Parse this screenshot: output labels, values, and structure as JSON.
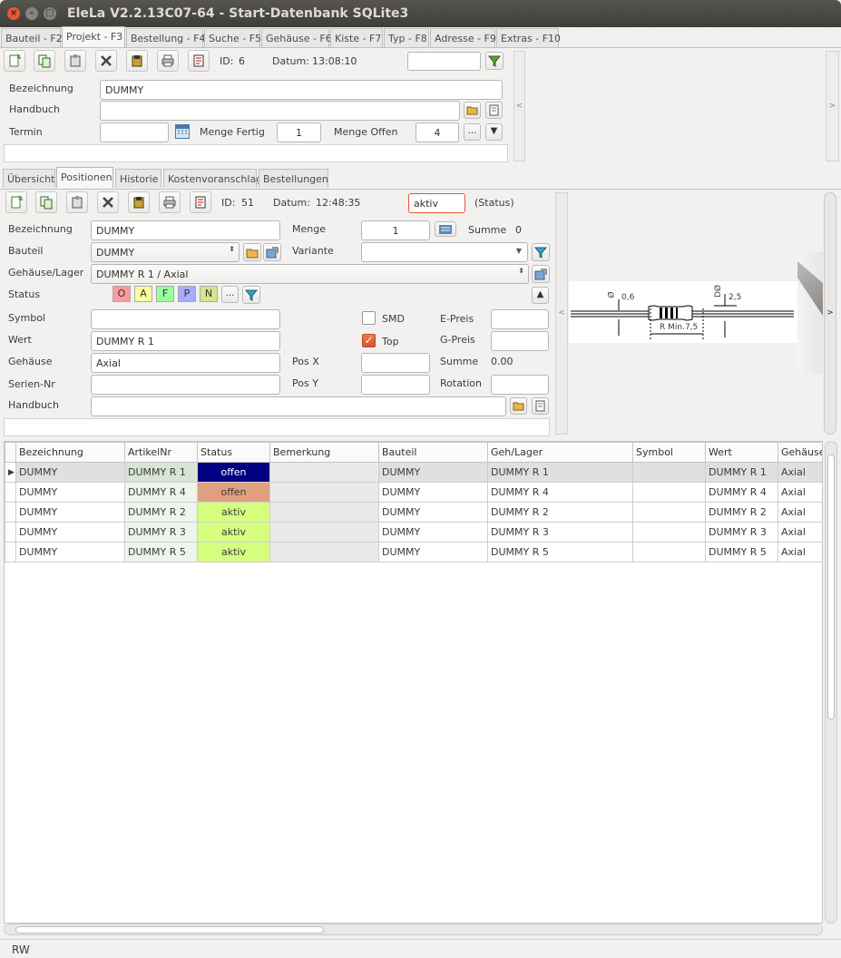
{
  "window": {
    "title": "EleLa V2.2.13C07-64  - Start-Datenbank SQLite3"
  },
  "main_tabs": [
    "Bauteil - F2",
    "Projekt - F3",
    "Bestellung - F4",
    "Suche - F5",
    "Gehäuse - F6",
    "Kiste - F7",
    "Typ - F8",
    "Adresse - F9",
    "Extras - F10"
  ],
  "project": {
    "id_label": "ID:",
    "id_value": "6",
    "date_label": "Datum:",
    "date_value": "13:08:10",
    "filter_value": "",
    "bezeichnung_label": "Bezeichnung",
    "bezeichnung_value": "DUMMY",
    "handbuch_label": "Handbuch",
    "handbuch_value": "",
    "termin_label": "Termin",
    "termin_value": "",
    "menge_fertig_label": "Menge Fertig",
    "menge_fertig_value": "1",
    "menge_offen_label": "Menge Offen",
    "menge_offen_value": "4",
    "ellipsis": "...",
    "arrow_down": "▼",
    "right_arrow": ">",
    "left_arrow": "<"
  },
  "sub_tabs": [
    "Übersicht",
    "Positionen",
    "Historie",
    "Kostenvoranschlag",
    "Bestellungen"
  ],
  "position": {
    "id_label": "ID:",
    "id_value": "51",
    "date_label": "Datum:",
    "date_value": "12:48:35",
    "status_value": "aktiv",
    "status_hint": "(Status)",
    "bezeichnung_label": "Bezeichnung",
    "bezeichnung_value": "DUMMY",
    "menge_label": "Menge",
    "menge_value": "1",
    "summe_label": "Summe",
    "summe_value": "0",
    "bauteil_label": "Bauteil",
    "bauteil_value": "DUMMY",
    "variante_label": "Variante",
    "variante_value": "",
    "gehaeuse_lager_label": "Gehäuse/Lager",
    "gehaeuse_lager_value": "DUMMY R 1 / Axial",
    "status_label": "Status",
    "status_chips": [
      "O",
      "A",
      "F",
      "P",
      "N"
    ],
    "chip_ellipsis": "...",
    "symbol_label": "Symbol",
    "symbol_value": "",
    "smd_label": "SMD",
    "smd_checked": false,
    "epreis_label": "E-Preis",
    "epreis_value": "",
    "wert_label": "Wert",
    "wert_value": "DUMMY R 1",
    "top_label": "Top",
    "top_checked": true,
    "gpreis_label": "G-Preis",
    "gpreis_value": "",
    "gehaeuse_label": "Gehäuse",
    "gehaeuse_value": "Axial",
    "posx_label": "Pos X",
    "posx_value": "",
    "summe2_label": "Summe",
    "summe2_value": "0.00",
    "seriennr_label": "Serien-Nr",
    "seriennr_value": "",
    "posy_label": "Pos Y",
    "posy_value": "",
    "rotation_label": "Rotation",
    "rotation_value": "",
    "handbuch_label": "Handbuch",
    "handbuch_value": "",
    "arrow_up": "▲"
  },
  "footprint": {
    "d_wire": "0,6",
    "d_body": "2,5",
    "phi": "Ø",
    "dphi": "DØ",
    "rmin": "R Min.7,5"
  },
  "grid": {
    "columns": [
      "Bezeichnung",
      "ArtikelNr",
      "Status",
      "Bemerkung",
      "Bauteil",
      "Geh/Lager",
      "Symbol",
      "Wert",
      "Gehäuse"
    ],
    "rows": [
      {
        "bez": "DUMMY",
        "art": "DUMMY R 1",
        "status": "offen",
        "bem": "",
        "bauteil": "DUMMY",
        "geh": "DUMMY R 1",
        "sym": "",
        "wert": "DUMMY R 1",
        "gehaeuse": "Axial"
      },
      {
        "bez": "DUMMY",
        "art": "DUMMY R 4",
        "status": "offen",
        "bem": "",
        "bauteil": "DUMMY",
        "geh": "DUMMY R 4",
        "sym": "",
        "wert": "DUMMY R 4",
        "gehaeuse": "Axial"
      },
      {
        "bez": "DUMMY",
        "art": "DUMMY R 2",
        "status": "aktiv",
        "bem": "",
        "bauteil": "DUMMY",
        "geh": "DUMMY R 2",
        "sym": "",
        "wert": "DUMMY R 2",
        "gehaeuse": "Axial"
      },
      {
        "bez": "DUMMY",
        "art": "DUMMY R 3",
        "status": "aktiv",
        "bem": "",
        "bauteil": "DUMMY",
        "geh": "DUMMY R 3",
        "sym": "",
        "wert": "DUMMY R 3",
        "gehaeuse": "Axial"
      },
      {
        "bez": "DUMMY",
        "art": "DUMMY R 5",
        "status": "aktiv",
        "bem": "",
        "bauteil": "DUMMY",
        "geh": "DUMMY R 5",
        "sym": "",
        "wert": "DUMMY R 5",
        "gehaeuse": "Axial"
      }
    ]
  },
  "statusbar": {
    "text": "RW"
  },
  "colors": {
    "offen_selected": "#000080",
    "offen": "#e0a080",
    "aktiv": "#d6ff80",
    "accent": "#e8542c"
  }
}
